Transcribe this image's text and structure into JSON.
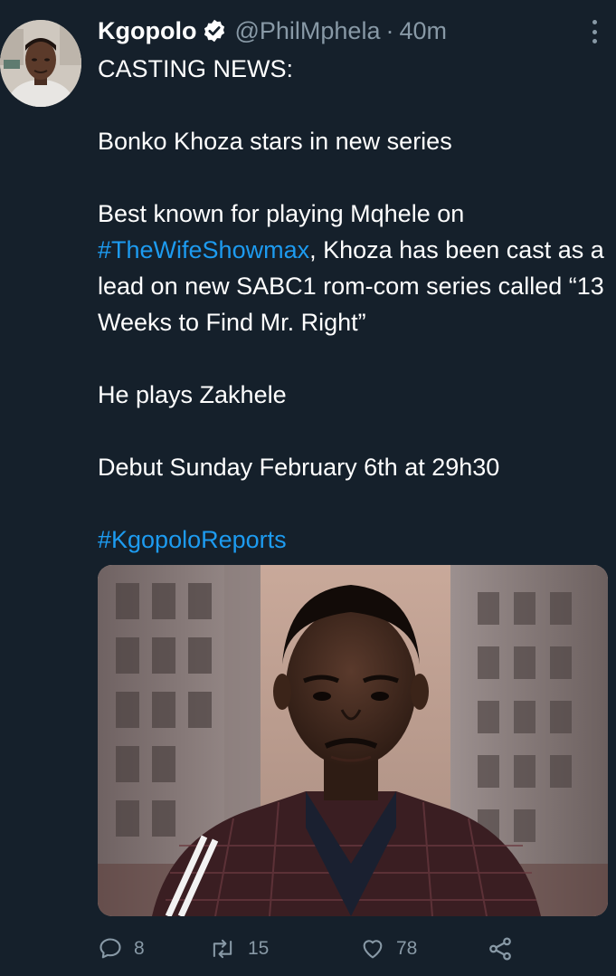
{
  "tweet": {
    "author": {
      "display_name": "Kgopolo",
      "handle": "@PhilMphela",
      "verified": true
    },
    "timestamp": "40m",
    "separator": "·",
    "lines": {
      "l1": "CASTING NEWS:",
      "l2": "Bonko Khoza stars in new series",
      "l3a": "Best known for playing Mqhele on",
      "l3_hashtag": "#TheWifeShowmax",
      "l3b": ", Khoza has been cast as a lead on new SABC1 rom-com series called “13 Weeks to Find Mr. Right”",
      "l4": "He plays Zakhele",
      "l5": "Debut Sunday February 6th at 29h30",
      "l6_hashtag": "#KgopoloReports"
    },
    "stats": {
      "replies": "8",
      "retweets": "15",
      "likes": "78"
    }
  },
  "colors": {
    "background": "#15202b",
    "text": "#ffffff",
    "secondary": "#8899a6",
    "link": "#1d9bf0"
  },
  "icons": {
    "verified": "verified-badge-icon",
    "more": "more-options-icon",
    "reply": "reply-icon",
    "retweet": "retweet-icon",
    "like": "heart-icon",
    "share": "share-icon"
  }
}
